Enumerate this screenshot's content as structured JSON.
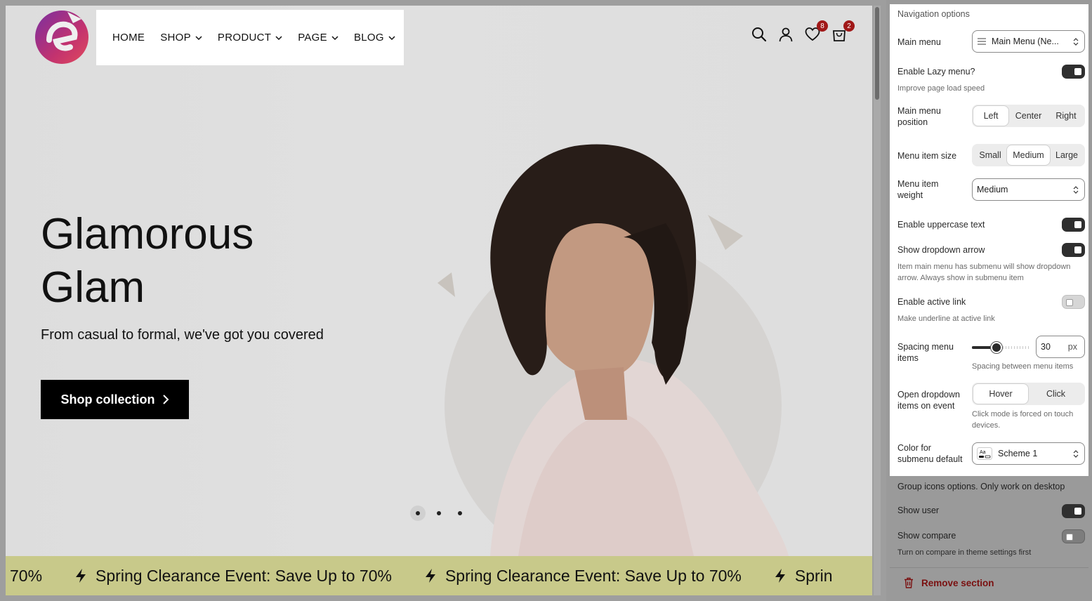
{
  "colors": {
    "badge": "#a01818",
    "remove": "#7a1010",
    "marquee_bg": "#c8c98a"
  },
  "header": {
    "logo_icon": "brand-e-logo",
    "nav": [
      {
        "label": "HOME",
        "has_dropdown": false
      },
      {
        "label": "SHOP",
        "has_dropdown": true
      },
      {
        "label": "PRODUCT",
        "has_dropdown": true
      },
      {
        "label": "PAGE",
        "has_dropdown": true
      },
      {
        "label": "BLOG",
        "has_dropdown": true
      }
    ],
    "wishlist_count": "8",
    "cart_count": "2"
  },
  "hero": {
    "title_line1": "Glamorous",
    "title_line2": "Glam",
    "subtitle": "From casual to formal, we've got you covered",
    "button_label": "Shop collection",
    "slides": 3,
    "active_slide": 1
  },
  "marquee": {
    "lead_text": "70%",
    "items": [
      "Spring Clearance Event: Save Up to 70%",
      "Spring Clearance Event: Save Up to 70%",
      "Sprin"
    ]
  },
  "panel": {
    "section_title": "Navigation options",
    "main_menu": {
      "label": "Main menu",
      "value": "Main Menu (Ne..."
    },
    "lazy_menu": {
      "label": "Enable Lazy menu?",
      "help": "Improve page load speed",
      "on": true
    },
    "menu_position": {
      "label": "Main menu position",
      "options": [
        "Left",
        "Center",
        "Right"
      ],
      "selected": "Left"
    },
    "item_size": {
      "label": "Menu item size",
      "options": [
        "Small",
        "Medium",
        "Large"
      ],
      "selected": "Medium"
    },
    "item_weight": {
      "label": "Menu item weight",
      "value": "Medium"
    },
    "uppercase": {
      "label": "Enable uppercase text",
      "on": true
    },
    "dropdown_arrow": {
      "label": "Show dropdown arrow",
      "help": "Item main menu has submenu will show dropdown arrow. Always show in submenu item",
      "on": true
    },
    "active_link": {
      "label": "Enable active link",
      "help": "Make underline at active link",
      "on": false
    },
    "spacing": {
      "label": "Spacing menu items",
      "value": "30",
      "unit": "px",
      "help": "Spacing between menu items",
      "level": 0.42
    },
    "open_event": {
      "label": "Open dropdown items on event",
      "options": [
        "Hover",
        "Click"
      ],
      "selected": "Hover",
      "help": "Click mode is forced on touch devices."
    },
    "submenu_color": {
      "label": "Color for submenu default",
      "value": "Scheme 1",
      "icon": "color-scheme-icon"
    }
  },
  "below_panel": {
    "group_icons": "Group icons options. Only work on desktop",
    "show_user": {
      "label": "Show user",
      "on": true
    },
    "show_compare": {
      "label": "Show compare",
      "help": "Turn on compare in theme settings first",
      "on": false
    },
    "remove_label": "Remove section"
  }
}
